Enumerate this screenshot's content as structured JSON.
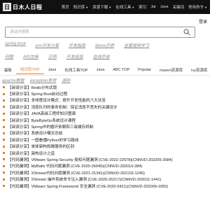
{
  "header": {
    "logo_mark": "日",
    "logo_text": "日木人日程",
    "nav": [
      {
        "label": "首页",
        "caret": false
      },
      {
        "label": "知识库",
        "caret": true
      },
      {
        "label": "资源下载",
        "caret": true
      },
      {
        "label": "在线工具",
        "caret": true
      },
      {
        "label": "索引",
        "caret": false
      },
      {
        "label": "Jar",
        "caret": false
      },
      {
        "label": "Java",
        "caret": false
      },
      {
        "label": "关键词",
        "caret": false
      },
      {
        "label": "常用命令",
        "caret": true
      }
    ]
  },
  "login": "登录",
  "search": {
    "placeholder": "请站内搜索",
    "value": ""
  },
  "keywords_row1": [
    "spring boot",
    "jvm开发分享",
    "开发指南",
    "demo示例",
    "全套视频学习"
  ],
  "keywords_row2": [
    "问题",
    "API文档",
    "示例",
    "开发经验",
    "在线手册"
  ],
  "tabs": [
    {
      "label": "最新",
      "active": false
    },
    {
      "label": "知识库TOP",
      "active": true
    },
    {
      "label": "Java",
      "active": false
    },
    {
      "label": "在线工具TOP",
      "active": false
    },
    {
      "label": "Java",
      "active": false
    },
    {
      "label": "ABC TOP",
      "active": false
    },
    {
      "label": "Popular",
      "active": false
    },
    {
      "label": "maven资源库",
      "active": false
    },
    {
      "label": "ivy资源库",
      "active": false
    }
  ],
  "tags_row2": [
    "apache教程",
    "exception异常",
    "源码"
  ],
  "list": [
    "【阅读分享】Redis分布式锁",
    "【阅读分享】Spring Boot启动过程",
    "【阅读分享】多线程设计模式：提升开发性能的六大法宝",
    "【阅读分享】消息队列的事务机制：保证消息不丢失的关键设计",
    "【阅读分享】JAVA高级工程师知识图谱",
    "【阅读分享】ByteByteGo系统设计课程",
    "【阅读分享】Spring中的循环依赖和三级缓存机制",
    "【阅读分享】系统设计模式总结",
    "【阅读分享】一图看懂Python的学习路线",
    "【阅读分享】单体架构和微服务的区别",
    "【阅读分享】架构设计之道",
    "【代码漏洞】VMware Spring Security 授权问题漏洞 (CVE-2022-22978)(CNNVD-202205-3584)",
    "【代码漏洞】MyBatis 代码问题漏洞 (CVE-2020-26945)(CNNVD-202010-384)",
    "【代码漏洞】XStream代码问题漏洞 (CVE-2021-21341)(CNNVD-202103-1246)",
    "【代码漏洞】XStream 操作系统命令注入漏洞 (CVE-2020-26217)(CNNVD-202011-1441)",
    "【代码漏洞】VMware Spring Framework 安全漏洞 (CVE-2020-5421)(CNNVD-202009-1050)"
  ]
}
